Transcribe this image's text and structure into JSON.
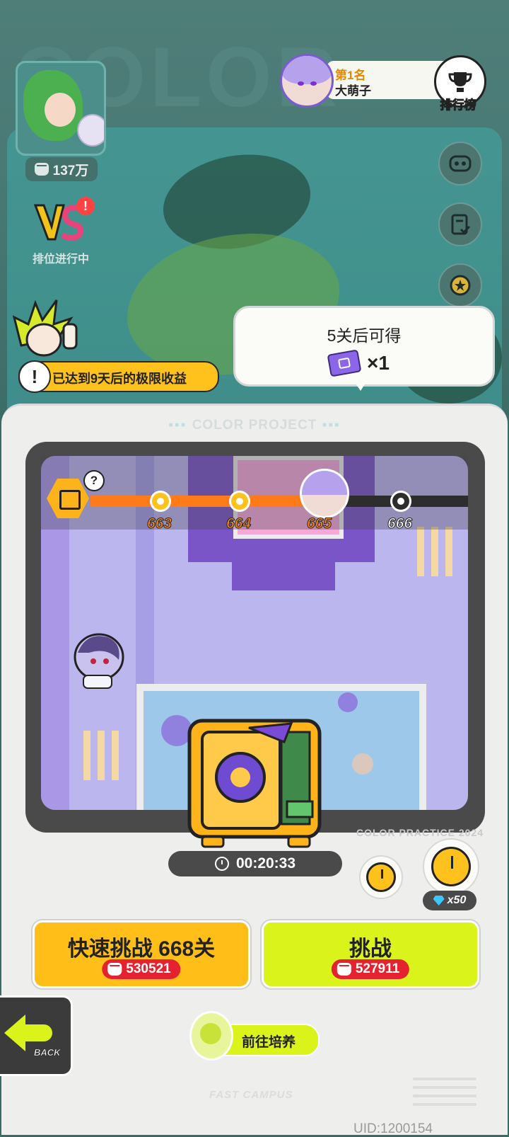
{
  "background": {
    "deco_letters": "COLOR"
  },
  "player": {
    "power": "137万"
  },
  "ranked": {
    "label": "排位进行中",
    "alert": "!"
  },
  "leaderboard": {
    "rank": "第1名",
    "name": "大萌子",
    "button_label": "排行榜"
  },
  "reward_toast": {
    "title": "5关后可得",
    "item_icon": "ticket-icon",
    "quantity": "×1"
  },
  "tip": {
    "icon": "!",
    "text": "已达到9天后的极限收益"
  },
  "panel": {
    "title": "COLOR PROJECT",
    "map_watermark": "COLOR PRACTICE 2024",
    "footer_watermark": "FAST CAMPUS"
  },
  "progress": {
    "help": "?",
    "levels": [
      {
        "label": "663",
        "state": "done"
      },
      {
        "label": "664",
        "state": "done"
      },
      {
        "label": "665",
        "state": "current"
      },
      {
        "label": "666",
        "state": "todo"
      }
    ]
  },
  "timer": {
    "value": "00:20:33"
  },
  "speedup": {
    "cost": "x50",
    "currency_icon": "diamond-icon"
  },
  "buttons": {
    "quick_challenge": {
      "label": "快速挑战 668关",
      "power": "530521"
    },
    "challenge": {
      "label": "挑战",
      "power": "527911"
    },
    "back": "BACK",
    "train": "前往培养"
  },
  "uid": "UID:1200154",
  "colors": {
    "accent_orange": "#ff7b1a",
    "accent_yellow": "#ffbe18",
    "accent_lime": "#d9f31b",
    "power_red": "#e5222f"
  }
}
